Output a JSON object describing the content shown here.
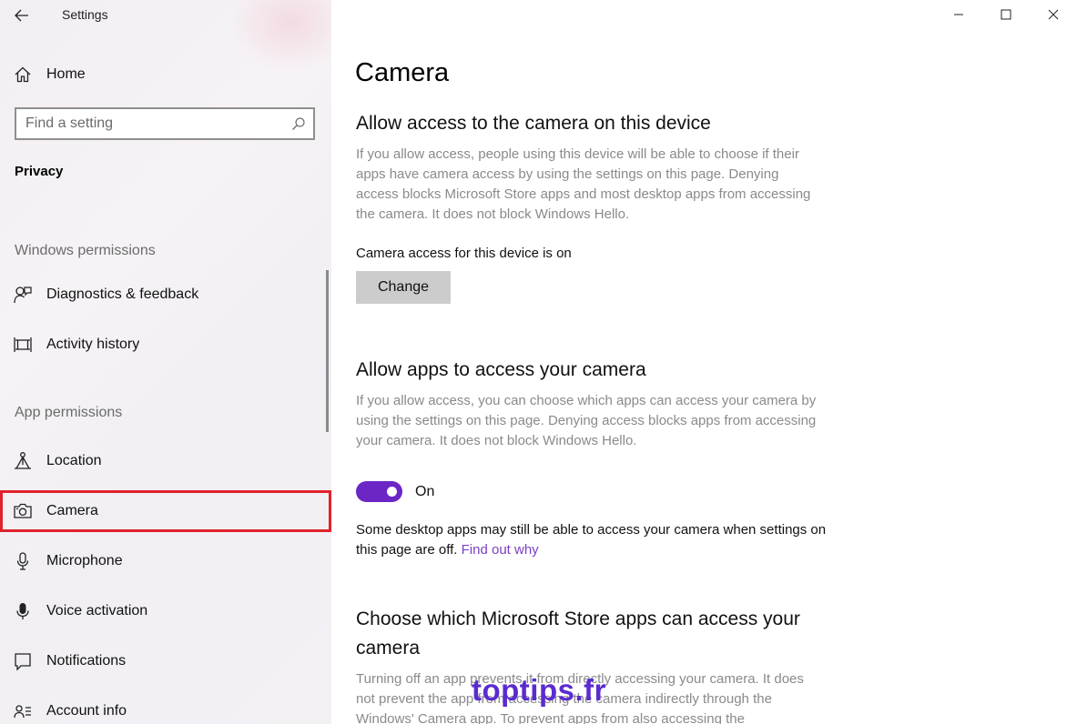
{
  "window": {
    "title": "Settings",
    "controls": [
      "minimize-icon",
      "maximize-icon",
      "close-icon"
    ]
  },
  "sidebar": {
    "home_label": "Home",
    "search": {
      "placeholder": "Find a setting",
      "value": ""
    },
    "section": "Privacy",
    "groups": [
      {
        "header": "Windows permissions",
        "items": [
          {
            "label": "Diagnostics & feedback",
            "icon": "diagnostics-icon"
          },
          {
            "label": "Activity history",
            "icon": "activity-history-icon"
          }
        ]
      },
      {
        "header": "App permissions",
        "items": [
          {
            "label": "Location",
            "icon": "location-icon"
          },
          {
            "label": "Camera",
            "icon": "camera-icon",
            "selected": true
          },
          {
            "label": "Microphone",
            "icon": "microphone-icon"
          },
          {
            "label": "Voice activation",
            "icon": "voice-activation-icon"
          },
          {
            "label": "Notifications",
            "icon": "notifications-icon"
          },
          {
            "label": "Account info",
            "icon": "account-info-icon"
          }
        ]
      }
    ]
  },
  "main": {
    "title": "Camera",
    "device_access": {
      "heading": "Allow access to the camera on this device",
      "description": "If you allow access, people using this device will be able to choose if their apps have camera access by using the settings on this page. Denying access blocks Microsoft Store apps and most desktop apps from accessing the camera. It does not block Windows Hello.",
      "status": "Camera access for this device is on",
      "button_label": "Change"
    },
    "app_access": {
      "heading": "Allow apps to access your camera",
      "description": "If you allow access, you can choose which apps can access your camera by using the settings on this page. Denying access blocks apps from accessing your camera. It does not block Windows Hello.",
      "toggle_state": "On",
      "note": "Some desktop apps may still be able to access your camera when settings on this page are off.",
      "link": "Find out why"
    },
    "store_apps": {
      "heading": "Choose which Microsoft Store apps can access your camera",
      "description": "Turning off an app prevents it from directly accessing your camera. It does not prevent the app from accessing the camera indirectly through the Windows' Camera app. To prevent apps from also accessing the"
    }
  },
  "colors": {
    "accent": "#6b26c5",
    "link": "#7a3fc6",
    "selection_outline": "#e0222a",
    "watermark": "#5b2bd0"
  },
  "watermark": {
    "text": "toptips",
    "suffix": ".fr"
  }
}
